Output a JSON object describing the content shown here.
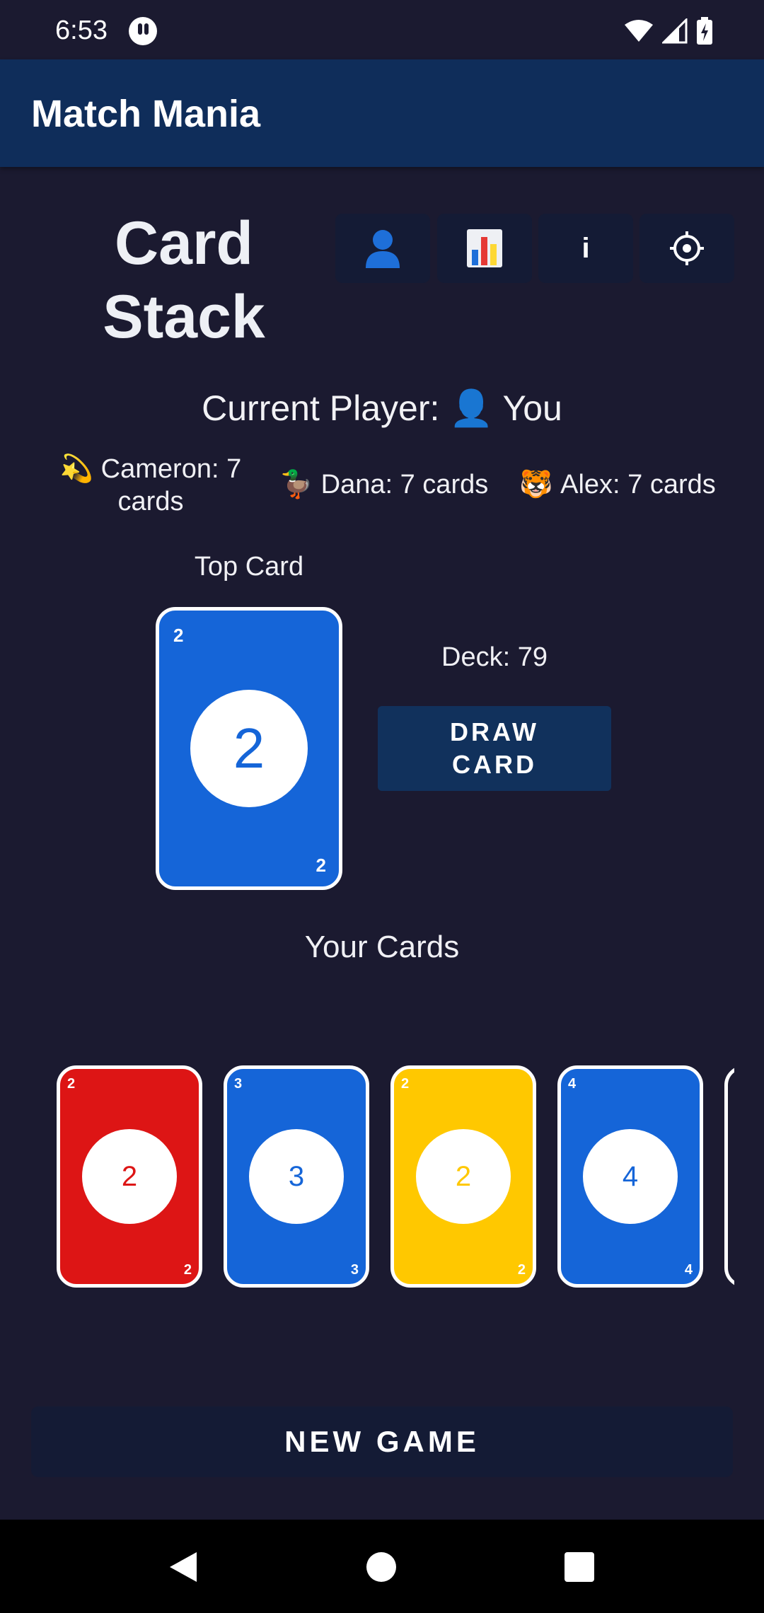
{
  "status_bar": {
    "time": "6:53"
  },
  "app_bar": {
    "title": "Match Mania"
  },
  "header": {
    "title_line1": "Card",
    "title_line2": "Stack",
    "buttons": [
      {
        "name": "profile-icon",
        "glyph": "👤"
      },
      {
        "name": "stats-icon",
        "glyph": "📊"
      },
      {
        "name": "info-icon",
        "glyph": "i"
      },
      {
        "name": "settings-icon",
        "glyph": "⚙"
      }
    ]
  },
  "game": {
    "current_player": "Current Player: 👤 You",
    "opponents": [
      {
        "emoji": "💫",
        "text_line1": "Cameron: 7",
        "text_line2": "cards"
      },
      {
        "emoji": "🦆",
        "text_line1": "Dana: 7 cards"
      },
      {
        "emoji": "🐯",
        "text_line1": "Alex: 7 cards"
      }
    ],
    "top_card_label": "Top Card",
    "top_card": {
      "value": "2",
      "color": "#1565d8"
    },
    "deck_label": "Deck: 79",
    "draw_button": "DRAW CARD",
    "your_cards_label": "Your Cards",
    "hand": [
      {
        "value": "2",
        "color": "#dd1515"
      },
      {
        "value": "3",
        "color": "#1565d8"
      },
      {
        "value": "2",
        "color": "#ffc800"
      },
      {
        "value": "4",
        "color": "#1565d8"
      }
    ],
    "new_game_button": "NEW GAME"
  }
}
